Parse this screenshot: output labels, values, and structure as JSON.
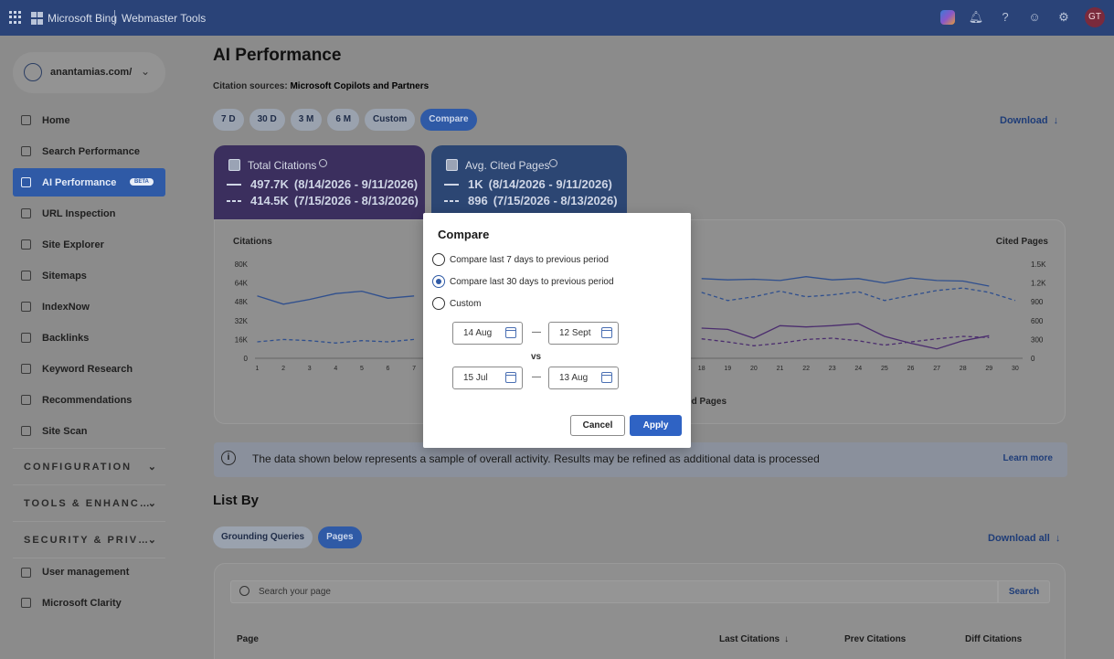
{
  "header": {
    "brand": "Microsoft Bing",
    "product": "Webmaster Tools",
    "avatar_initials": "GT"
  },
  "sidebar": {
    "site": "anantamias.com/",
    "items": [
      {
        "label": "Home"
      },
      {
        "label": "Search Performance"
      },
      {
        "label": "AI Performance",
        "badge": "BETA"
      },
      {
        "label": "URL Inspection"
      },
      {
        "label": "Site Explorer"
      },
      {
        "label": "Sitemaps"
      },
      {
        "label": "IndexNow"
      },
      {
        "label": "Backlinks"
      },
      {
        "label": "Keyword Research"
      },
      {
        "label": "Recommendations"
      },
      {
        "label": "Site Scan"
      }
    ],
    "sections": [
      {
        "label": "CONFIGURATION"
      },
      {
        "label": "TOOLS & ENHANC…"
      },
      {
        "label": "SECURITY & PRIV…"
      }
    ],
    "footer_items": [
      {
        "label": "User management"
      },
      {
        "label": "Microsoft Clarity"
      }
    ]
  },
  "main": {
    "title": "AI Performance",
    "sources_label": "Citation sources:",
    "sources_value": "Microsoft Copilots and Partners",
    "ranges": [
      {
        "label": "7 D"
      },
      {
        "label": "30 D"
      },
      {
        "label": "3 M"
      },
      {
        "label": "6 M"
      },
      {
        "label": "Custom"
      },
      {
        "label": "Compare"
      }
    ],
    "download": "Download",
    "metrics": [
      {
        "title": "Total Citations",
        "current_value": "497.7K",
        "current_range": "(8/14/2026 - 9/11/2026)",
        "previous_value": "414.5K",
        "previous_range": "(7/15/2026 - 8/13/2026)"
      },
      {
        "title": "Avg. Cited Pages",
        "current_value": "1K",
        "current_range": "(8/14/2026 - 9/11/2026)",
        "previous_value": "896",
        "previous_range": "(7/15/2026 - 8/13/2026)"
      }
    ],
    "chart_labels": {
      "left_axis": "Citations",
      "right_axis": "Cited Pages",
      "legend_partial": "ited Pages"
    },
    "info_banner": "The data shown below represents a sample of overall activity. Results may be refined as additional data is processed",
    "learn_more": "Learn more",
    "list_by": "List By",
    "list_tabs": [
      {
        "label": "Grounding Queries"
      },
      {
        "label": "Pages"
      }
    ],
    "download_all": "Download all",
    "search_placeholder": "Search your page",
    "search_button": "Search",
    "columns": [
      "Page",
      "Last Citations",
      "Prev Citations",
      "Diff Citations"
    ]
  },
  "modal": {
    "title": "Compare",
    "options": [
      {
        "label": "Compare last 7 days to previous period",
        "selected": false
      },
      {
        "label": "Compare last 30 days to previous period",
        "selected": true
      },
      {
        "label": "Custom",
        "selected": false
      }
    ],
    "range_a_start": "14 Aug",
    "range_a_end": "12 Sept",
    "vs": "vs",
    "range_b_start": "15 Jul",
    "range_b_end": "13 Aug",
    "dash": "—",
    "cancel": "Cancel",
    "apply": "Apply"
  },
  "chart_data": {
    "type": "line",
    "x_left_visible": [
      1,
      2,
      3,
      4,
      5,
      6,
      7
    ],
    "x_right_visible": [
      18,
      19,
      20,
      21,
      22,
      23,
      24,
      25,
      26,
      27,
      28,
      29,
      30
    ],
    "y_left_ticks": [
      "80K",
      "64K",
      "48K",
      "32K",
      "16K",
      "0"
    ],
    "y_right_ticks": [
      "1.5K",
      "1.2K",
      "900",
      "600",
      "300",
      "0"
    ],
    "ylim_left": [
      0,
      80000
    ],
    "ylim_right": [
      0,
      1500
    ],
    "series": [
      {
        "axis": "left",
        "style": "solid",
        "x": [
          1,
          2,
          3,
          4,
          5,
          6,
          7
        ],
        "values": [
          53000,
          46000,
          50000,
          55000,
          57000,
          51000,
          53000
        ]
      },
      {
        "axis": "left",
        "style": "dashed",
        "x": [
          1,
          2,
          3,
          4,
          5,
          6,
          7
        ],
        "values": [
          14000,
          16000,
          15000,
          13000,
          15000,
          14000,
          16000
        ]
      },
      {
        "axis": "right",
        "style": "solid",
        "x": [
          18,
          19,
          20,
          21,
          22,
          23,
          24,
          25,
          26,
          27,
          28,
          29
        ],
        "values": [
          1270,
          1250,
          1260,
          1240,
          1300,
          1250,
          1270,
          1200,
          1280,
          1240,
          1230,
          1150
        ]
      },
      {
        "axis": "right",
        "style": "dashed",
        "x": [
          18,
          19,
          20,
          21,
          22,
          23,
          24,
          25,
          26,
          27,
          28,
          29,
          30
        ],
        "values": [
          1050,
          920,
          980,
          1070,
          980,
          1010,
          1060,
          920,
          1000,
          1080,
          1120,
          1050,
          920
        ]
      },
      {
        "axis": "right",
        "style": "solid-purple",
        "x": [
          18,
          19,
          20,
          21,
          22,
          23,
          24,
          25,
          26,
          27,
          28,
          29
        ],
        "values": [
          480,
          460,
          320,
          520,
          500,
          520,
          550,
          350,
          240,
          150,
          280,
          360
        ]
      },
      {
        "axis": "right",
        "style": "dashed-purple",
        "x": [
          18,
          19,
          20,
          21,
          22,
          23,
          24,
          25,
          26,
          27,
          28,
          29
        ],
        "values": [
          310,
          260,
          200,
          240,
          300,
          320,
          280,
          210,
          260,
          310,
          350,
          330
        ]
      }
    ],
    "colors": {
      "primary": "#2f5aa6",
      "secondary": "#3b2f5e"
    }
  }
}
